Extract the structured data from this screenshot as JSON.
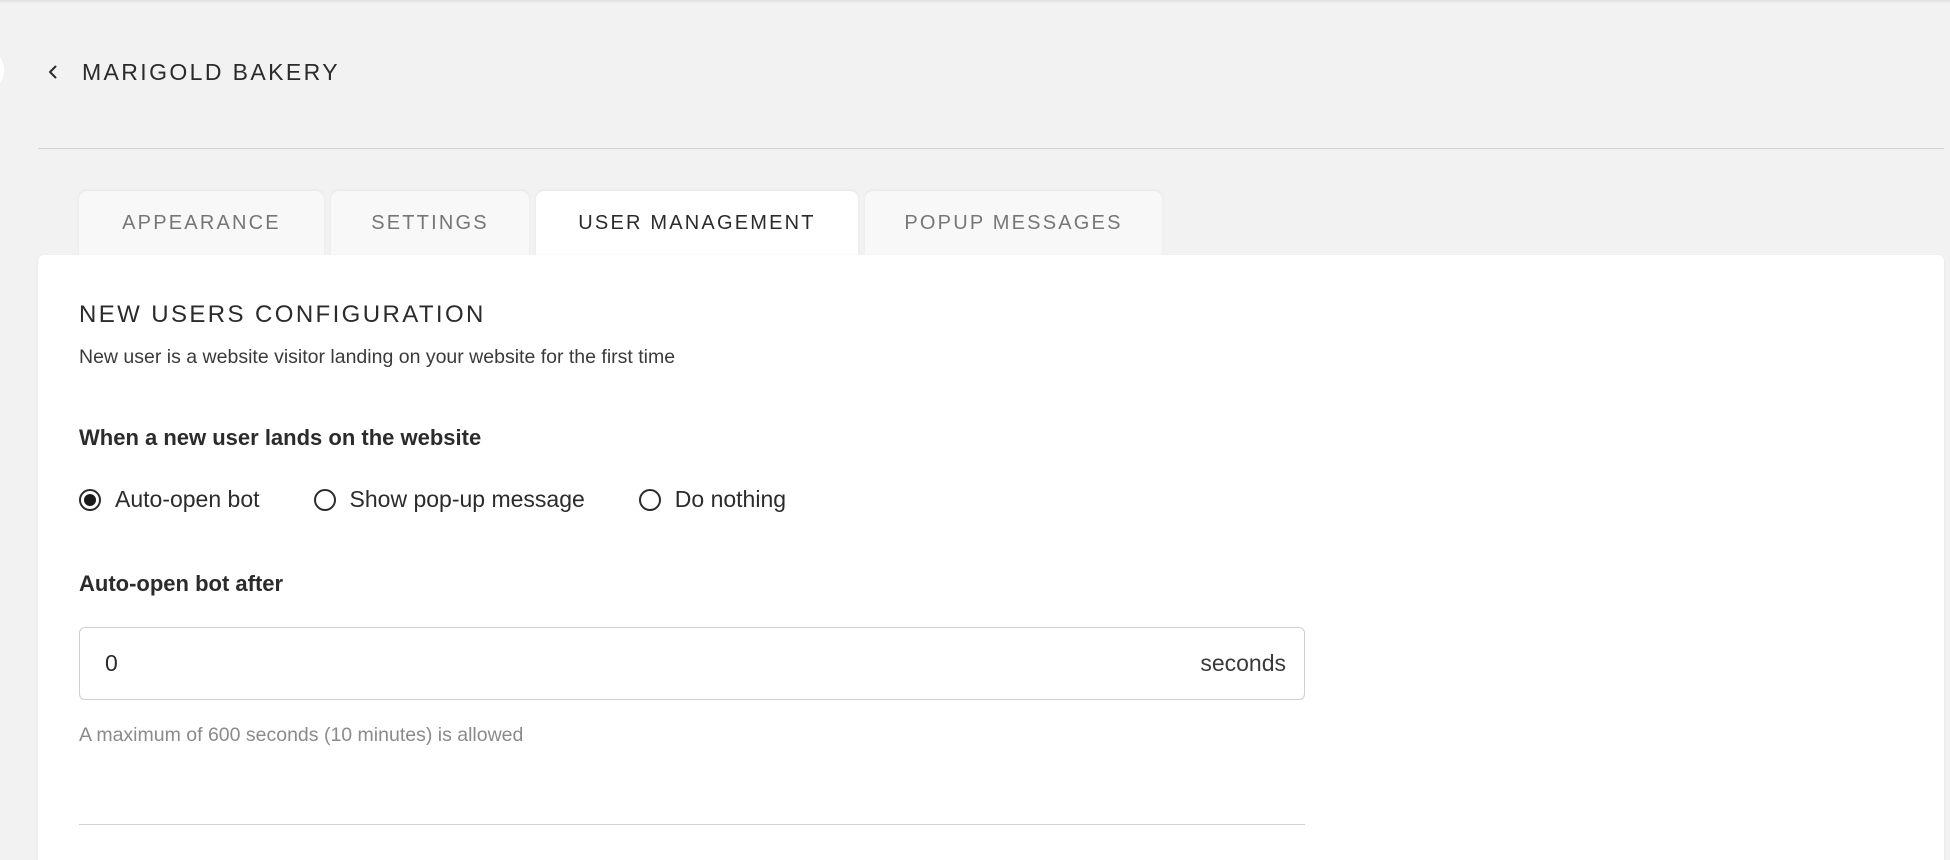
{
  "header": {
    "back_icon": "chevron-left-icon",
    "title": "MARIGOLD BAKERY"
  },
  "tabs": [
    {
      "label": "APPEARANCE",
      "active": false
    },
    {
      "label": "SETTINGS",
      "active": false
    },
    {
      "label": "USER MANAGEMENT",
      "active": true
    },
    {
      "label": "POPUP MESSAGES",
      "active": false
    }
  ],
  "section": {
    "title": "NEW USERS CONFIGURATION",
    "description": "New user is a website visitor landing on your website for the first time"
  },
  "landing": {
    "label": "When a new user lands on the website",
    "options": [
      {
        "label": "Auto-open bot",
        "selected": true
      },
      {
        "label": "Show pop-up message",
        "selected": false
      },
      {
        "label": "Do nothing",
        "selected": false
      }
    ]
  },
  "auto_open": {
    "label": "Auto-open bot after",
    "value": "0",
    "suffix": "seconds",
    "hint": "A maximum of 600 seconds (10 minutes) is allowed"
  },
  "colors": {
    "page_bg": "#f2f2f2",
    "panel_bg": "#ffffff",
    "text_primary": "#2b2b2b",
    "text_muted": "#8a8a8a",
    "tab_inactive_text": "#767676"
  }
}
